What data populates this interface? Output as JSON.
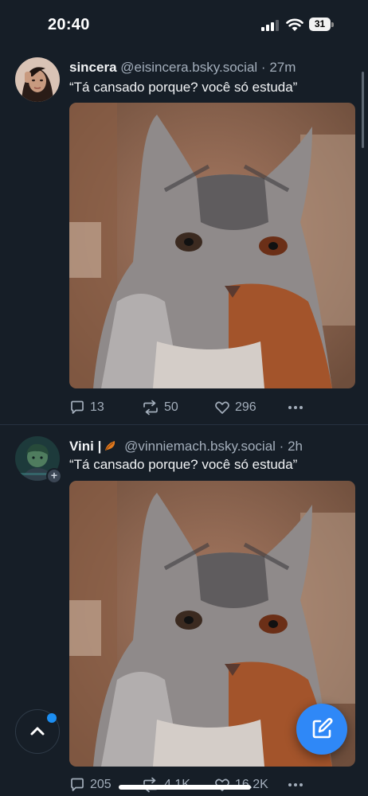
{
  "status_bar": {
    "time": "20:40",
    "battery": "31"
  },
  "posts": [
    {
      "name": "sincera",
      "handle": "@eisincera.bsky.social",
      "separator": "·",
      "age": "27m",
      "text": "“Tá cansado porque? você só estuda”",
      "replies": "13",
      "reposts": "50",
      "likes": "296"
    },
    {
      "name": "Vini |",
      "handle": "@vinniemach.bsky.social",
      "separator": "·",
      "age": "2h",
      "text": "“Tá cansado porque? você só estuda”",
      "replies": "205",
      "reposts": "4.1K",
      "likes": "16.2K"
    }
  ],
  "colors": {
    "background": "#161e27",
    "accent": "#2f88f7",
    "muted": "#a3aebb"
  },
  "icons": [
    "signal-icon",
    "wifi-icon",
    "battery-icon",
    "reply-icon",
    "repost-icon",
    "like-icon",
    "more-icon",
    "chevron-up-icon",
    "compose-icon",
    "leaf-icon",
    "plus-icon"
  ]
}
